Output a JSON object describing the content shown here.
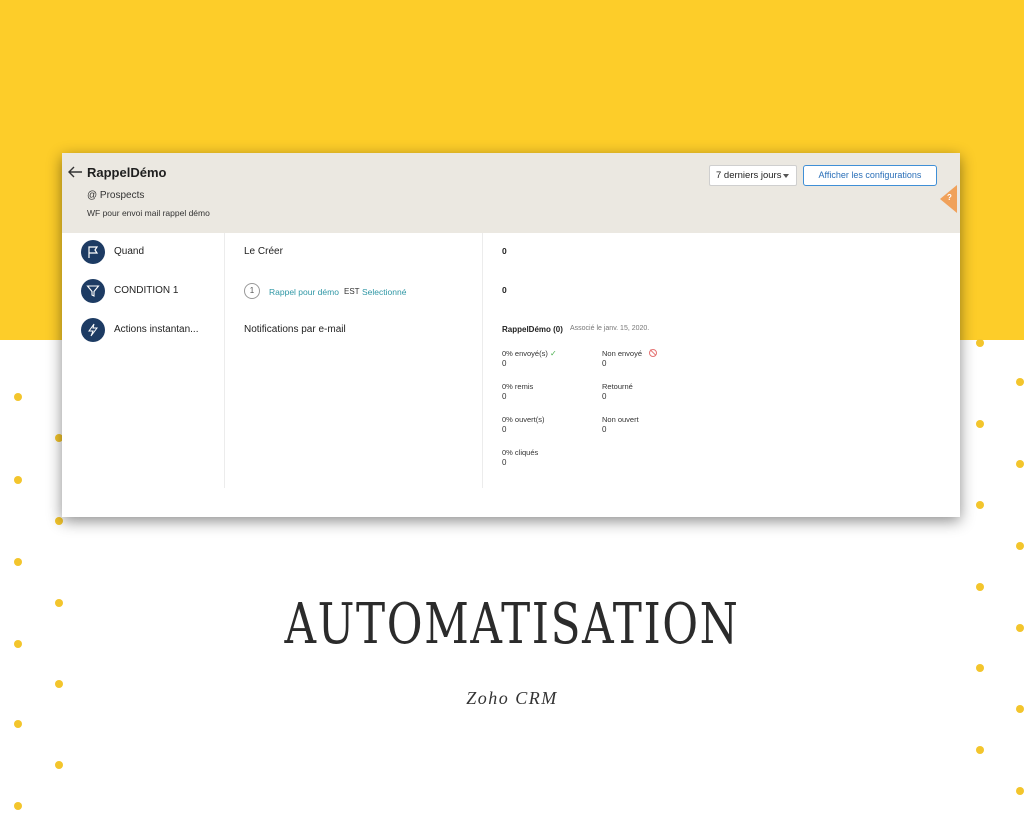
{
  "header": {
    "title": "RappelDémo",
    "module": "@ Prospects",
    "description": "WF pour envoi mail rappel démo",
    "range_select": "7 derniers jours",
    "config_button": "Afficher les configurations",
    "help": "?"
  },
  "steps": [
    {
      "label": "Quand",
      "icon": "flag-icon",
      "detail": "Le Créer",
      "count": "0"
    },
    {
      "label": "CONDITION 1",
      "icon": "filter-icon",
      "count": "0"
    },
    {
      "label": "Actions instantan...",
      "icon": "bolt-icon",
      "detail": "Notifications par e-mail"
    }
  ],
  "condition": {
    "number": "1",
    "field": "Rappel pour démo",
    "operator": "EST",
    "value": "Selectionné"
  },
  "email": {
    "name": "RappelDémo (0)",
    "associated": "Associé le janv. 15, 2020.",
    "stats": [
      {
        "label": "0% envoyé(s)",
        "value": "0"
      },
      {
        "label": "Non envoyé",
        "value": "0"
      },
      {
        "label": "0% remis",
        "value": "0"
      },
      {
        "label": "Retourné",
        "value": "0"
      },
      {
        "label": "0% ouvert(s)",
        "value": "0"
      },
      {
        "label": "Non ouvert",
        "value": "0"
      },
      {
        "label": "0% cliqués",
        "value": "0"
      }
    ]
  },
  "heading": "AUTOMATISATION",
  "subheading": "Zoho CRM",
  "colors": {
    "yellow": "#fdcd29",
    "navy": "#1d3b63",
    "link": "#2f97a5",
    "button_border": "#3f8fd6"
  }
}
